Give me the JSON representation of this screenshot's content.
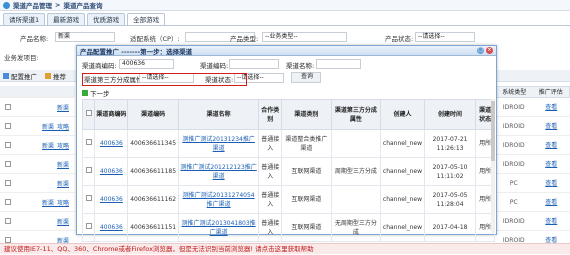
{
  "breadcrumb": [
    "渠道产品管理",
    ">",
    "渠道产品查询"
  ],
  "tabs": [
    "请所渠道1",
    "最新游戏",
    "优质游戏",
    "全部游戏"
  ],
  "filter": {
    "product_name_label": "产品名称:",
    "product_name_value": "新渠",
    "os_label": "适配系统（CP）:",
    "os_value": "",
    "product_type_label": "产品类型:",
    "product_type_value": "--业务类型--",
    "product_status_label": "产品状态:",
    "product_status_value": "--请选择--",
    "biz_project_label": "业务发项目:"
  },
  "toolbar": {
    "config": "配置推广",
    "promote": "推荐"
  },
  "dialog": {
    "title": "产品配置推广 -------第一步：选择渠道",
    "channel_id_label": "渠道商编码:",
    "channel_id_value": "400636",
    "channel_no_label": "渠道编码:",
    "channel_name_label": "渠道名称:",
    "third_attr_label": "渠道第三方分成属性:",
    "third_attr_value": "--请选择--",
    "channel_status_label": "渠道状态:",
    "channel_status_value": "--请选择--",
    "query_button": "查询",
    "next_step": "下一步",
    "columns": [
      "渠道商编码",
      "渠道编码",
      "渠道名称",
      "合作类别",
      "渠道类别",
      "渠道第三方分成属性",
      "创建人",
      "创建时间",
      "渠道状态"
    ],
    "rows": [
      {
        "id": "400636",
        "code": "400636611345",
        "name": "测推广测试20131234推广渠道",
        "coop": "普通接入",
        "type": "渠道整合类推广渠道",
        "attr": "",
        "creator": "channel_new",
        "date": "2017-07-21",
        "time": "11:26:13",
        "status": "用所"
      },
      {
        "id": "400636",
        "code": "400636611185",
        "name": "测推广测试201212123推广渠道",
        "coop": "普通接入",
        "type": "互联网渠道",
        "attr": "周期型三方分成",
        "creator": "channel_new",
        "date": "2017-05-10",
        "time": "11:11:02",
        "status": "用所"
      },
      {
        "id": "400636",
        "code": "400636611162",
        "name": "测推广测试20131274054推广渠道",
        "coop": "普通接入",
        "type": "互联网渠道",
        "attr": "",
        "creator": "channel_new",
        "date": "2017-05-05",
        "time": "11:28:04",
        "status": "用所"
      },
      {
        "id": "400636",
        "code": "400636611151",
        "name": "测推广测试201304180​3推广渠道",
        "coop": "普通接入",
        "type": "互联网渠道",
        "attr": "无周期型三方分成",
        "creator": "channel_new",
        "date": "2017-04-18",
        "time": "",
        "status": "用所"
      }
    ]
  },
  "right_table": {
    "columns": [
      "系统类型",
      "推广评估"
    ],
    "rows": [
      {
        "os": "IDROID",
        "act": "查看"
      },
      {
        "os": "IDROID",
        "act": "查看"
      },
      {
        "os": "IDROID",
        "act": "查看"
      },
      {
        "os": "IDROID",
        "act": "查看"
      },
      {
        "os": "PC",
        "act": "查看"
      },
      {
        "os": "PC",
        "act": "查看"
      },
      {
        "os": "IDROID",
        "act": "查看"
      },
      {
        "os": "IDROID",
        "act": "查看"
      }
    ]
  },
  "left_rows": [
    "新渠",
    "新渠_攻略",
    "新渠_攻略",
    "新渠",
    "新渠",
    "新渠_攻略",
    "新渠",
    "新渠"
  ],
  "footer": "建议使用IE7-11、QQ、360、Chrome或者Firefox浏览器，但是无法识别当前浏览器! 请点击这里获取帮助",
  "colors": {
    "accent": "#1a5fb4",
    "highlight": "#d21d1d",
    "footer": "#c01818"
  }
}
